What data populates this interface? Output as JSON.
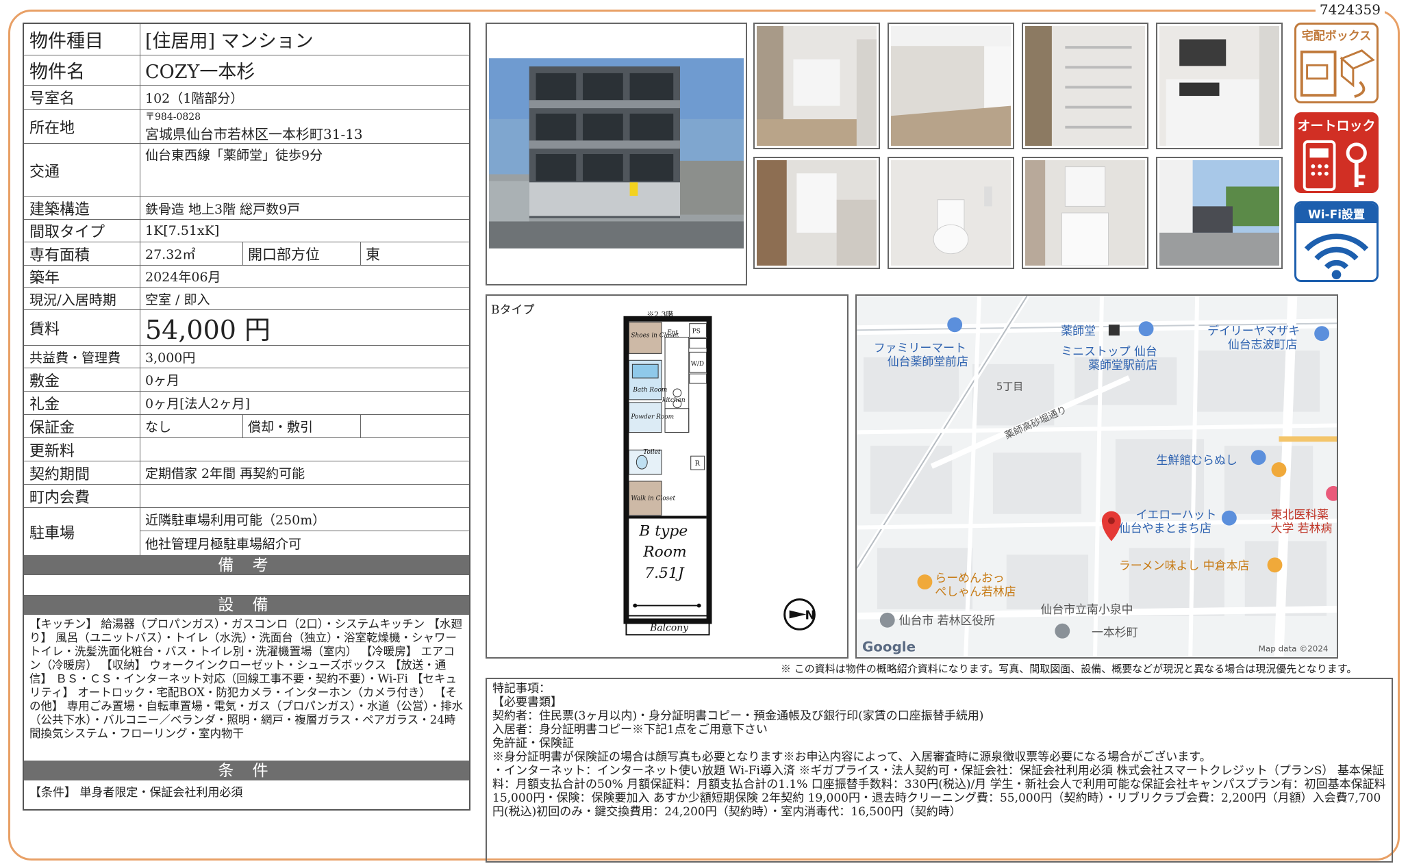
{
  "listing_id": "7424359",
  "spec": {
    "type_label": "物件種目",
    "type_value": "[住居用] マンション",
    "name_label": "物件名",
    "name_value": "COZY一本杉",
    "room_label": "号室名",
    "room_value": "102（1階部分）",
    "address_label": "所在地",
    "postal": "〒984-0828",
    "address": "宮城県仙台市若林区一本杉町31-13",
    "access_label": "交通",
    "access_value": "仙台東西線「薬師堂」徒歩9分",
    "structure_label": "建築構造",
    "structure_value": "鉄骨造 地上3階 総戸数9戸",
    "layout_label": "間取タイプ",
    "layout_value": "1K[7.51xK]",
    "area_label": "専有面積",
    "area_value": "27.32㎡",
    "opening_label": "開口部方位",
    "opening_value": "東",
    "built_label": "築年",
    "built_value": "2024年06月",
    "status_label": "現況/入居時期",
    "status_value": "空室 / 即入",
    "rent_label": "賃料",
    "rent_value": "54,000 円",
    "fee_label": "共益費・管理費",
    "fee_value": "3,000円",
    "deposit_label": "敷金",
    "deposit_value": "0ヶ月",
    "key_label": "礼金",
    "key_value": "0ヶ月[法人2ヶ月]",
    "guarantee_label": "保証金",
    "guarantee_value": "なし",
    "amort_label": "償却・敷引",
    "amort_value": "",
    "renewal_label": "更新料",
    "renewal_value": "",
    "contract_label": "契約期間",
    "contract_value": "定期借家 2年間 再契約可能",
    "town_label": "町内会費",
    "town_value": "",
    "parking_label": "駐車場",
    "parking_value1": "近隣駐車場利用可能（250m）",
    "parking_value2": "他社管理月極駐車場紹介可"
  },
  "remarks_head": "備 考",
  "equip_head": "設 備",
  "equip_text": "【キッチン】 給湯器（プロパンガス）・ガスコンロ（2口）・システムキッチン 【水廻り】 風呂（ユニットバス）・トイレ（水洗）・洗面台（独立）・浴室乾燥機・シャワートイレ・洗髪洗面化粧台・バス・トイレ別・洗濯機置場（室内） 【冷暖房】 エアコン（冷暖房） 【収納】 ウォークインクローゼット・シューズボックス 【放送・通信】 ＢＳ・ＣＳ・インターネット対応（回線工事不要・契約不要）・Wi-Fi 【セキュリティ】 オートロック・宅配BOX・防犯カメラ・インターホン（カメラ付き） 【その他】 専用ごみ置場・自転車置場・電気・ガス（プロパンガス）・水道（公営）・排水（公共下水）・バルコニー／ベランダ・照明・網戸・複層ガラス・ペアガラス・24時間換気システム・フローリング・室内物干",
  "cond_head": "条 件",
  "cond_text": "【条件】 単身者限定・保証会社利用必須",
  "badges": {
    "delivery": "宅配ボックス",
    "autolock": "オートロック",
    "wifi": "Wi-Fi設置"
  },
  "floorplan": {
    "label": "Bタイプ",
    "height_note": "※2,3階",
    "shoes": "Shoes in Closet",
    "ent": "Ent",
    "bath": "Bath Room",
    "powder": "Powder Room",
    "kitchen": "kitchen",
    "toilet": "Toilet",
    "walkin": "Walk in Closet",
    "wd": "W/D",
    "ps": "PS",
    "r": "R",
    "room_title": "B type",
    "room_name": "Room",
    "room_size": "7.51J",
    "balcony": "Balcony"
  },
  "map": {
    "labels": {
      "yakushido": "薬師堂",
      "famima1": "ファミリーマート",
      "famima2": "仙台薬師堂前店",
      "ministop1": "ミニストップ 仙台",
      "ministop2": "薬師堂駅前店",
      "daily1": "デイリーヤマザキ",
      "daily2": "仙台志波町店",
      "chome": "5丁目",
      "street": "薬師高砂堀通り",
      "seisen": "生鮮館むらぬし",
      "yellowhat1": "イエローハット",
      "yellowhat2": "仙台やまとまち店",
      "tohoku1": "東北医科薬",
      "tohoku2": "大学 若林病",
      "ramen": "ラーメン味よし 中倉本店",
      "raamen1": "らーめんおっ",
      "raamen2": "ぺしゃん若林店",
      "school": "仙台市立南小泉中",
      "ward": "仙台市 若林区役所",
      "ippon": "一本杉町",
      "google": "Google",
      "mapdata": "Map data ©2024"
    }
  },
  "disclaimer": "※ この資料は物件の概略紹介資料になります。写真、間取図面、設備、概要などが現況と異なる場合は現況優先となります。",
  "notes": {
    "title": "特記事項：",
    "l1": "【必要書類】",
    "l2": "契約者：住民票(3ヶ月以内)・身分証明書コピー・預金通帳及び銀行印(家賃の口座振替手続用)",
    "l3": "入居者：身分証明書コピー※下記1点をご用意下さい",
    "l4": "免許証・保険証",
    "l5": "※身分証明書が保険証の場合は顔写真も必要となります※お申込内容によって、入居審査時に源泉徴収票等必要になる場合がございます。",
    "l6": "・インターネット：インターネット使い放題 Wi-Fi導入済 ※ギガプライス・法人契約可・保証会社：保証会社利用必須 株式会社スマートクレジット（プランS） 基本保証料：月額支払合計の50% 月額保証料：月額支払合計の1.1% 口座振替手数料：330円(税込)/月 学生・新社会人で利用可能な保証会社キャンパスプラン有：初回基本保証料15,000円・保険：保険要加入 あすか少額短期保険 2年契約 19,000円・退去時クリーニング費：55,000円（契約時）・リブリクラブ会費：2,200円（月額）入会費7,700円(税込)初回のみ・鍵交換費用：24,200円（契約時）・室内消毒代：16,500円（契約時）"
  }
}
